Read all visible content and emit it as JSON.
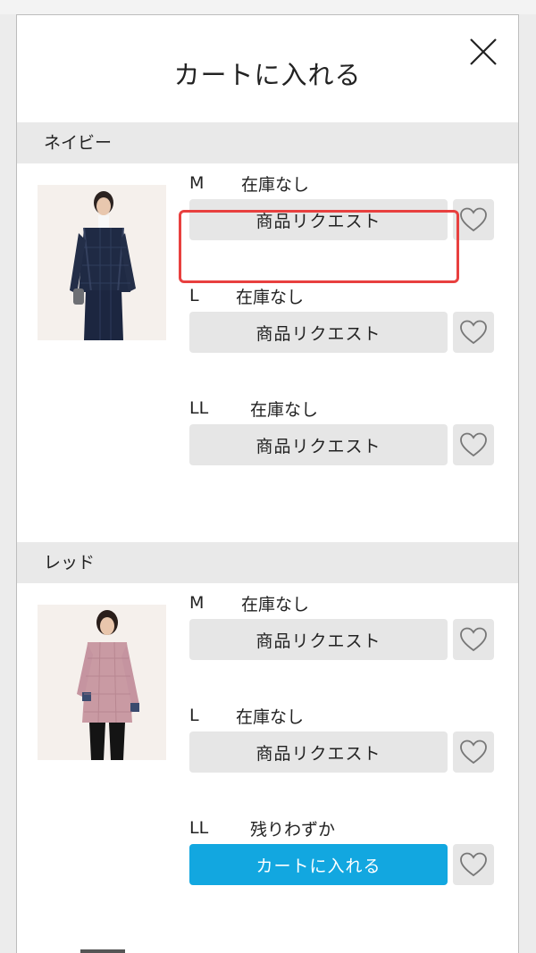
{
  "modal": {
    "title": "カートに入れる",
    "close_icon": "close-icon"
  },
  "colors": [
    {
      "name": "ネイビー",
      "image": "navy-plaid-jacket-model",
      "sizes": [
        {
          "size": "M",
          "stock": "在庫なし",
          "action": "商品リクエスト",
          "action_type": "request"
        },
        {
          "size": "L",
          "stock": "在庫なし",
          "action": "商品リクエスト",
          "action_type": "request"
        },
        {
          "size": "LL",
          "stock": "在庫なし",
          "action": "商品リクエスト",
          "action_type": "request"
        }
      ]
    },
    {
      "name": "レッド",
      "image": "red-check-shirt-model",
      "sizes": [
        {
          "size": "M",
          "stock": "在庫なし",
          "action": "商品リクエスト",
          "action_type": "request"
        },
        {
          "size": "L",
          "stock": "在庫なし",
          "action": "商品リクエスト",
          "action_type": "request"
        },
        {
          "size": "LL",
          "stock": "残りわずか",
          "action": "カートに入れる",
          "action_type": "cart"
        }
      ]
    }
  ],
  "icons": {
    "favorite": "heart-icon"
  },
  "colors_theme": {
    "cart_button": "#12a7e0",
    "request_button": "#e6e6e6",
    "highlight": "#e8403f",
    "section_header": "#e9e9e9"
  }
}
